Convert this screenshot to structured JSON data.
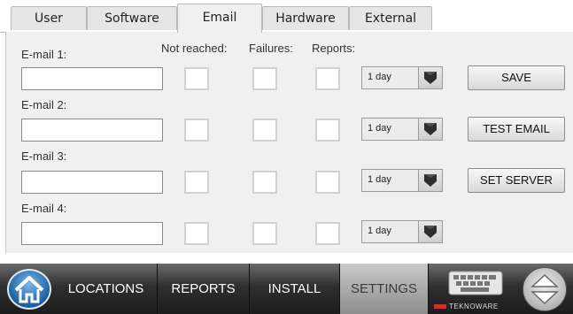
{
  "tabs": [
    {
      "label": "User"
    },
    {
      "label": "Software"
    },
    {
      "label": "Email"
    },
    {
      "label": "Hardware"
    },
    {
      "label": "External"
    }
  ],
  "active_tab": "Email",
  "columns": {
    "not_reached": "Not reached:",
    "failures": "Failures:",
    "reports": "Reports:"
  },
  "emails": [
    {
      "label": "E-mail 1:",
      "value": "",
      "interval": "1 day"
    },
    {
      "label": "E-mail 2:",
      "value": "",
      "interval": "1 day"
    },
    {
      "label": "E-mail 3:",
      "value": "",
      "interval": "1 day"
    },
    {
      "label": "E-mail 4:",
      "value": "",
      "interval": "1 day"
    }
  ],
  "buttons": {
    "save": "SAVE",
    "test_email": "TEST EMAIL",
    "set_server": "SET SERVER"
  },
  "bottom_nav": {
    "locations": "LOCATIONS",
    "reports": "REPORTS",
    "install": "INSTALL",
    "settings": "SETTINGS"
  },
  "logo_text": "TEKNOWARE",
  "icons": {
    "home": "home-icon",
    "keyboard": "keyboard-icon",
    "scroll": "up-down-icon",
    "dropdown": "chevron-down-icon"
  }
}
